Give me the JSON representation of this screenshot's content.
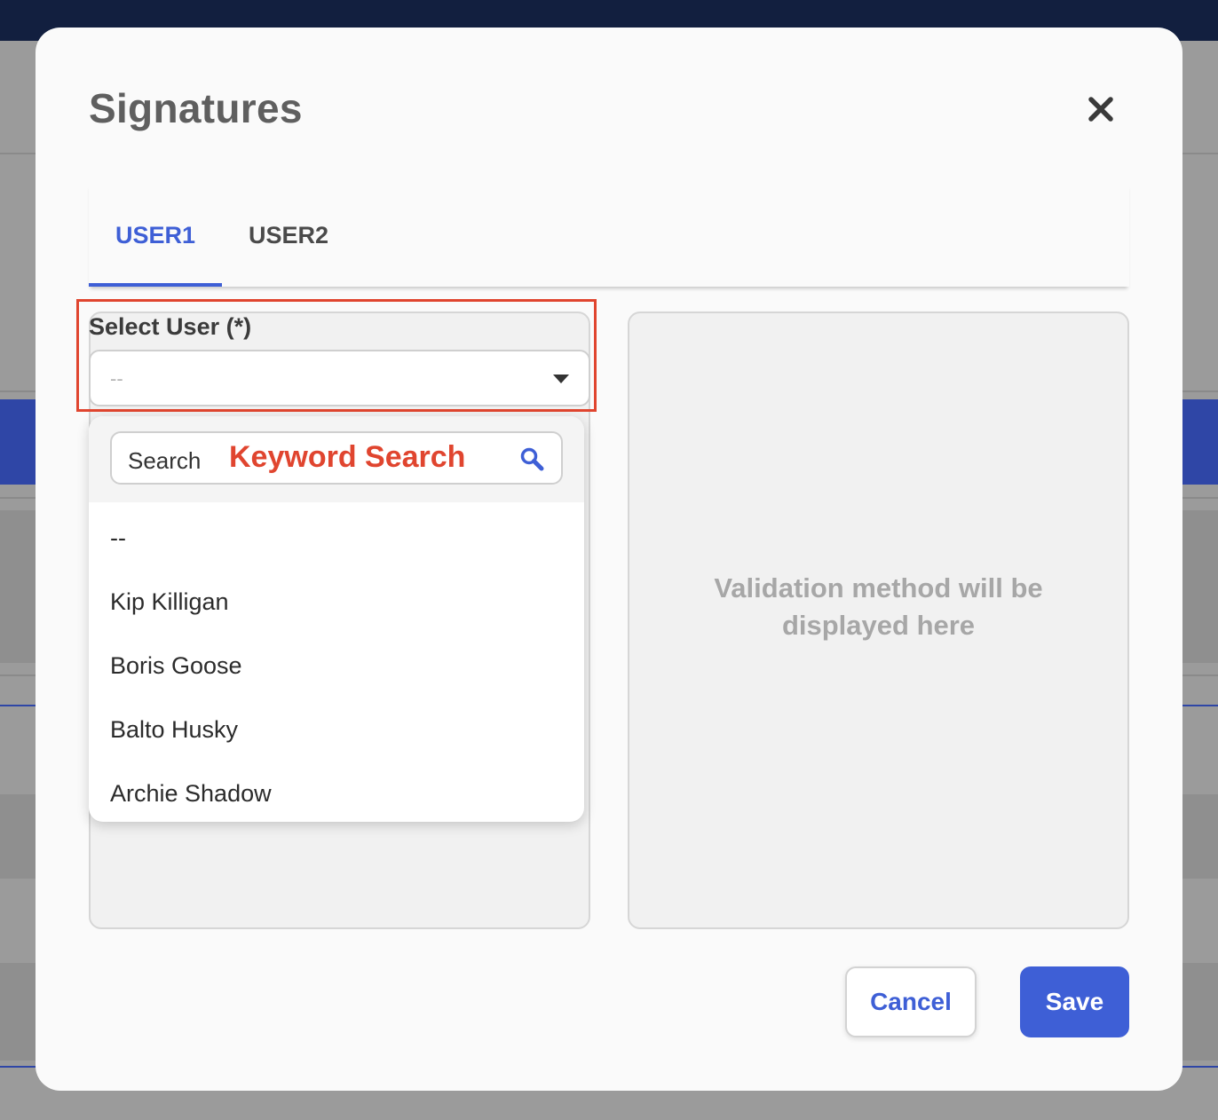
{
  "modal": {
    "title": "Signatures",
    "close_icon": "close-icon"
  },
  "tabs": [
    {
      "label": "USER1",
      "active": true
    },
    {
      "label": "USER2",
      "active": false
    }
  ],
  "select_user": {
    "label": "Select User (*)",
    "value": "--"
  },
  "dropdown": {
    "search_placeholder": "Search",
    "annotation": "Keyword Search",
    "search_icon": "search-icon",
    "options": [
      "--",
      "Kip Killigan",
      "Boris Goose",
      "Balto Husky",
      "Archie Shadow"
    ]
  },
  "validation_panel": {
    "placeholder": "Validation method will be displayed here"
  },
  "footer": {
    "cancel_label": "Cancel",
    "save_label": "Save"
  },
  "colors": {
    "accent": "#3e5fd6",
    "annotation": "#e0452f",
    "backdrop_topbar": "#121f3f"
  }
}
